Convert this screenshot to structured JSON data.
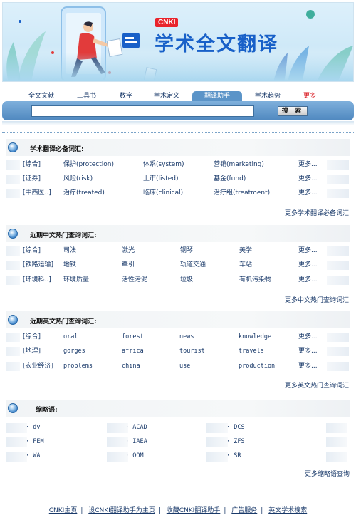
{
  "banner": {
    "brand_tag": "CNKI",
    "title": "学术全文翻译"
  },
  "tabs": [
    {
      "label": "全文文献",
      "active": false
    },
    {
      "label": "工具书",
      "active": false
    },
    {
      "label": "数字",
      "active": false
    },
    {
      "label": "学术定义",
      "active": false
    },
    {
      "label": "翻译助手",
      "active": true
    },
    {
      "label": "学术趋势",
      "active": false
    },
    {
      "label": "更多",
      "active": false
    }
  ],
  "search": {
    "value": "",
    "button_label": "搜 索"
  },
  "sections": [
    {
      "title": "学术翻译必备词汇:",
      "rows": [
        {
          "category": "[综合]",
          "items": [
            "保护(protection)",
            "体系(system)",
            "营销(marketing)"
          ],
          "more": "更多..."
        },
        {
          "category": "[证券]",
          "items": [
            "风险(risk)",
            "上市(listed)",
            "基金(fund)"
          ],
          "more": "更多..."
        },
        {
          "category": "[中西医..]",
          "items": [
            "治疗(treated)",
            "临床(clinical)",
            "治疗组(treatment)"
          ],
          "more": "更多..."
        }
      ],
      "footer_link": "更多学术翻译必备词汇"
    },
    {
      "title": "近期中文热门查询词汇:",
      "rows": [
        {
          "category": "[综合]",
          "items": [
            "司法",
            "激光",
            "钢琴",
            "美学"
          ],
          "more": "更多..."
        },
        {
          "category": "[铁路运输]",
          "items": [
            "地铁",
            "牵引",
            "轨道交通",
            "车站"
          ],
          "more": "更多..."
        },
        {
          "category": "[环境科..]",
          "items": [
            "环境质量",
            "活性污泥",
            "垃圾",
            "有机污染物"
          ],
          "more": "更多..."
        }
      ],
      "footer_link": "更多中文热门查询词汇"
    },
    {
      "title": "近期英文热门查询词汇:",
      "rows": [
        {
          "category": "[综合]",
          "items": [
            "oral",
            "forest",
            "news",
            "knowledge"
          ],
          "more": "更多..."
        },
        {
          "category": "[地理]",
          "items": [
            "gorges",
            "africa",
            "tourist",
            "travels"
          ],
          "more": "更多..."
        },
        {
          "category": "[农业经济]",
          "items": [
            "problems",
            "china",
            "use",
            "production"
          ],
          "more": "更多..."
        }
      ],
      "footer_link": "更多英文热门查询词汇"
    }
  ],
  "abbreviations": {
    "title": "缩略语:",
    "rows": [
      [
        "· dv",
        "· ACAD",
        "· DCS"
      ],
      [
        "· FEM",
        "· IAEA",
        "· ZFS"
      ],
      [
        "· WA",
        "· OOM",
        "· SR"
      ]
    ],
    "footer_link": "更多缩略语查询"
  },
  "footer": {
    "links": [
      "CNKI主页",
      "设CNKI翻译助手为主页",
      "收藏CNKI翻译助手",
      "广告服务",
      "英文学术搜索"
    ],
    "separator": "|"
  },
  "colors": {
    "brand_blue": "#1860c8",
    "brand_red": "#e9242c",
    "link_text": "#1a3a6a",
    "tab_active": "#5b94c8",
    "more_tab": "#d8141c"
  }
}
